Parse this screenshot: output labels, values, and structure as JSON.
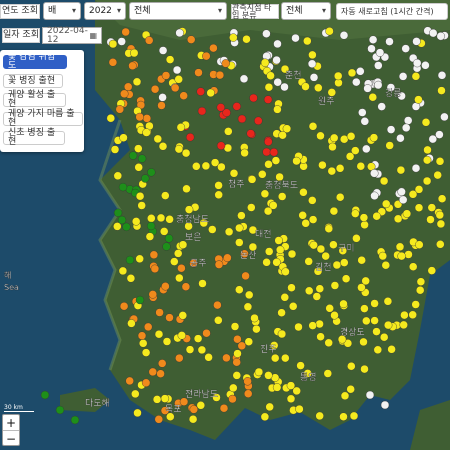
{
  "filters": {
    "view_label": "연도 조회",
    "species_value": "배",
    "year_value": "2022",
    "region_value": "전체",
    "station_type_label": "관측지점 타입 분류",
    "station_type_value": "전체",
    "auto_refresh_label": "자동 새로고침 (1시간 간격)",
    "date_label": "일자 조회",
    "date_value": "2022-04-12"
  },
  "layers": [
    {
      "label": "꽃 감염 위험도",
      "active": true
    },
    {
      "label": "꽃 병징 출현",
      "active": false
    },
    {
      "label": "궤양 활성 출현",
      "active": false
    },
    {
      "label": "궤양 가지 마름 출현",
      "active": false
    },
    {
      "label": "신초 병징 출현",
      "active": false
    }
  ],
  "map": {
    "zoom_in": "+",
    "zoom_out": "−",
    "scale_label": "30 km",
    "place_labels": [
      "춘천",
      "원주",
      "강릉",
      "충청북도",
      "충청남도",
      "청주",
      "대전",
      "보은",
      "공주",
      "논산",
      "김천",
      "구미",
      "경상도",
      "전라남도",
      "목포",
      "진주",
      "통영",
      "다도해",
      "해",
      "Sea"
    ]
  },
  "legend_colors": {
    "very_high": "#e8261c",
    "high": "#f08a1c",
    "moderate": "#f5ea1e",
    "low": "#1e8f1a",
    "none": "#f2f2f2"
  }
}
